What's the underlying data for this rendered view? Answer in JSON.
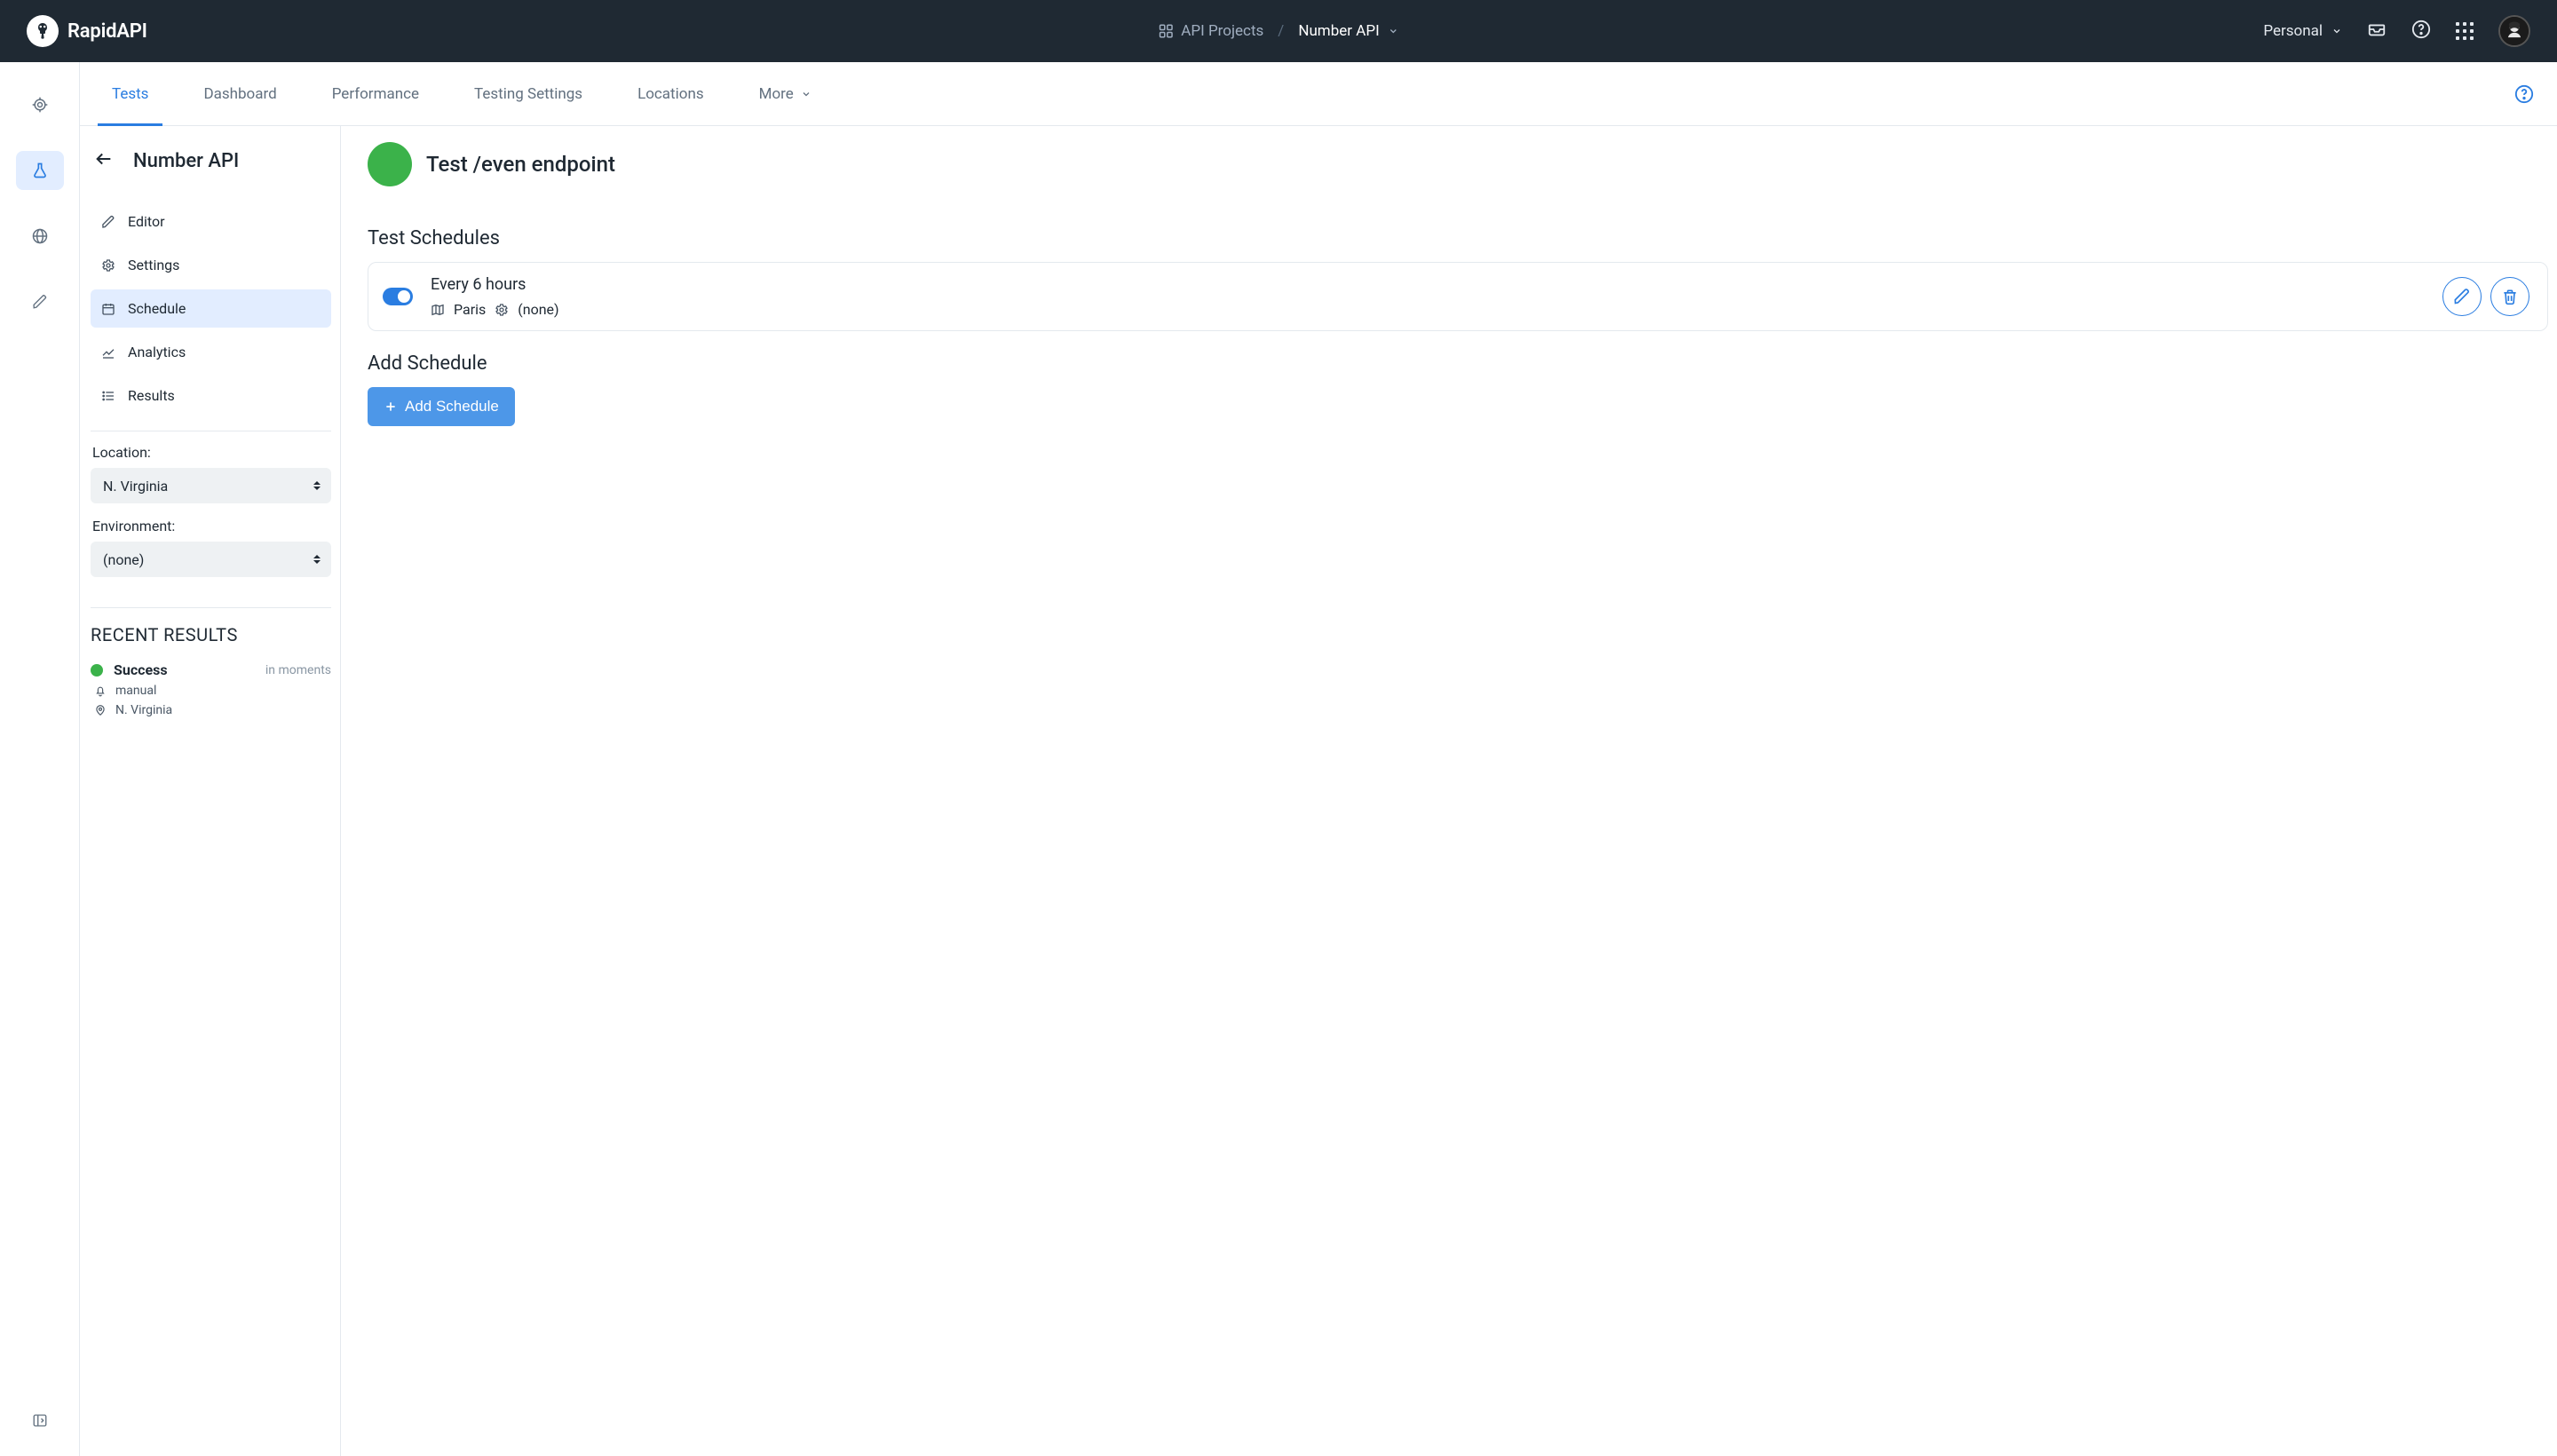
{
  "brand": "RapidAPI",
  "topnav": {
    "api_projects": "API Projects",
    "project_name": "Number API",
    "personal": "Personal"
  },
  "rail": {
    "items": [
      "target",
      "lab",
      "globe",
      "pencil"
    ]
  },
  "tabs": {
    "items": [
      "Tests",
      "Dashboard",
      "Performance",
      "Testing Settings",
      "Locations",
      "More"
    ],
    "active": 0
  },
  "sidebar": {
    "title": "Number API",
    "nav": [
      {
        "icon": "pencil",
        "label": "Editor"
      },
      {
        "icon": "gear",
        "label": "Settings"
      },
      {
        "icon": "calendar",
        "label": "Schedule"
      },
      {
        "icon": "chart",
        "label": "Analytics"
      },
      {
        "icon": "list",
        "label": "Results"
      }
    ],
    "active_nav": 2,
    "location_label": "Location:",
    "location_value": "N. Virginia",
    "env_label": "Environment:",
    "env_value": "(none)",
    "recent_title": "RECENT RESULTS",
    "recent": {
      "status": "Success",
      "time": "in moments",
      "trigger": "manual",
      "location": "N. Virginia"
    }
  },
  "panel": {
    "title": "Test /even endpoint",
    "schedules_title": "Test Schedules",
    "schedule": {
      "name": "Every 6 hours",
      "location": "Paris",
      "env": "(none)",
      "enabled": true
    },
    "add_title": "Add Schedule",
    "add_button": "Add Schedule"
  }
}
